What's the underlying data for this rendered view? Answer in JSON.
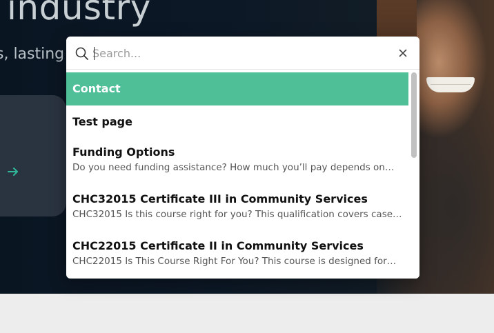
{
  "hero": {
    "heading": "industry",
    "subtitle": "s, lasting"
  },
  "search": {
    "placeholder": "Search...",
    "value": ""
  },
  "results": [
    {
      "title": "Contact",
      "description": "",
      "active": true
    },
    {
      "title": "Test page",
      "description": "",
      "active": false
    },
    {
      "title": "Funding Options",
      "description": "Do you need funding assistance? How much you’ll pay depends on…",
      "active": false
    },
    {
      "title": "CHC32015 Certificate III in Community Services",
      "description": "CHC32015 Is this course right for you? This qualification covers case…",
      "active": false
    },
    {
      "title": "CHC22015 Certificate II in Community Services",
      "description": "CHC22015 Is This Course Right For You? This course is designed for…",
      "active": false
    }
  ],
  "colors": {
    "accent": "#4fbf98",
    "hero_bg": "#0c1826",
    "page_bg": "#ededed"
  },
  "icons": {
    "search": "search-icon",
    "close": "close-icon",
    "arrow": "arrow-right-icon"
  }
}
